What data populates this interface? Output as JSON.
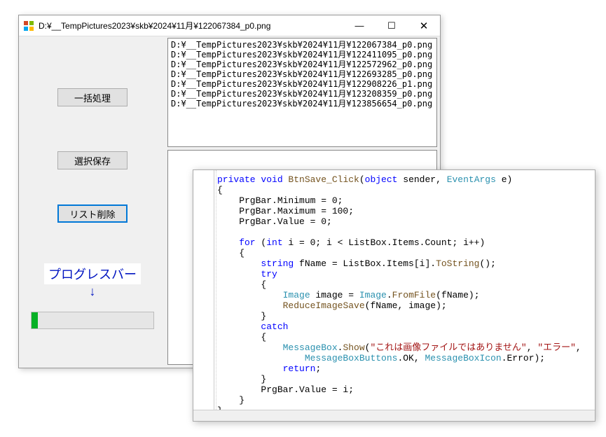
{
  "window": {
    "title": "D:¥__TempPictures2023¥skb¥2024¥11月¥122067384_p0.png",
    "minimize": "—",
    "maximize": "☐",
    "close": "✕"
  },
  "buttons": {
    "batch": "一括処理",
    "saveSel": "選択保存",
    "listDel": "リスト削除"
  },
  "progress": {
    "label": "プログレスバー",
    "arrow": "↓"
  },
  "list": [
    "D:¥__TempPictures2023¥skb¥2024¥11月¥122067384_p0.png",
    "D:¥__TempPictures2023¥skb¥2024¥11月¥122411095_p0.png",
    "D:¥__TempPictures2023¥skb¥2024¥11月¥122572962_p0.png",
    "D:¥__TempPictures2023¥skb¥2024¥11月¥122693285_p0.png",
    "D:¥__TempPictures2023¥skb¥2024¥11月¥122908226_p1.png",
    "D:¥__TempPictures2023¥skb¥2024¥11月¥123208359_p0.png",
    "D:¥__TempPictures2023¥skb¥2024¥11月¥123856654_p0.png"
  ],
  "code": {
    "l0a": "private",
    "l0b": " void",
    "l0c": " BtnSave_Click",
    "l0d": "(",
    "l0e": "object",
    "l0f": " sender, ",
    "l0g": "EventArgs",
    "l0h": " e)",
    "l1": "{",
    "l2": "    PrgBar.Minimum = 0;",
    "l3": "    PrgBar.Maximum = 100;",
    "l4": "    PrgBar.Value = 0;",
    "blank": "",
    "l6a": "    for",
    "l6b": " (",
    "l6c": "int",
    "l6d": " i = 0; i < ListBox.Items.Count; i++)",
    "l7": "    {",
    "l8a": "        string",
    "l8b": " fName = ListBox.Items[i].",
    "l8c": "ToString",
    "l8d": "();",
    "l9a": "        try",
    "l10": "        {",
    "l11a": "            Image",
    "l11b": " image = ",
    "l11c": "Image",
    "l11d": ".",
    "l11e": "FromFile",
    "l11f": "(fName);",
    "l12a": "            ",
    "l12b": "ReduceImageSave",
    "l12c": "(fName, image);",
    "l13": "        }",
    "l14a": "        catch",
    "l15": "        {",
    "l16a": "            ",
    "l16b": "MessageBox",
    "l16c": ".",
    "l16d": "Show",
    "l16e": "(",
    "l16f": "\"これは画像ファイルではありません\"",
    "l16g": ", ",
    "l16h": "\"エラー\"",
    "l16i": ",",
    "l17a": "                ",
    "l17b": "MessageBoxButtons",
    "l17c": ".OK, ",
    "l17d": "MessageBoxIcon",
    "l17e": ".Error);",
    "l18a": "            return",
    "l18b": ";",
    "l19": "        }",
    "l20": "        PrgBar.Value = i;",
    "l21": "    }",
    "l22": "}"
  }
}
